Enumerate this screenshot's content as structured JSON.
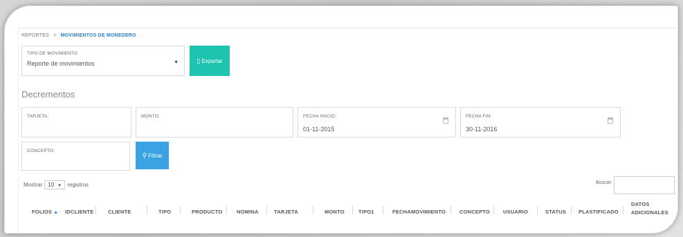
{
  "breadcrumb": {
    "parent": "REPORTES",
    "separator": ">",
    "current": "MOVIMIENTOS DE MONEDERO"
  },
  "movement_type": {
    "label": "TIPO DE MOVIMIENTO",
    "value": "Reporte de movimientos"
  },
  "export_button": {
    "label": "Exportar",
    "icon": "document-icon"
  },
  "section_title": "Decrementos",
  "filters": {
    "tarjeta": {
      "label": "TARJETA:"
    },
    "monto": {
      "label": "MONTO:"
    },
    "fecha_inicio": {
      "label": "FECHA INICIO:",
      "value": "01-11-2015"
    },
    "fecha_fin": {
      "label": "FECHA FIN:",
      "value": "30-11-2016"
    },
    "concepto": {
      "label": "CONCEPTO:"
    }
  },
  "filter_button": {
    "label": "Filtrar",
    "icon": "search-icon"
  },
  "table_length": {
    "prefix": "Mostrar",
    "value": "10",
    "suffix": "registros"
  },
  "search": {
    "label": "Buscar:"
  },
  "columns": [
    "FOLIOS",
    "IDCLIENTE",
    "CLIENTE",
    "TIPO",
    "PRODUCTO",
    "NOMINA",
    "TARJETA",
    "MONTO",
    "TIPO1",
    "FECHAMOVIMIENTO",
    "CONCEPTO",
    "USUARIO",
    "STATUS",
    "PLASTIFICADO",
    "DATOS",
    "ADICIONALES"
  ],
  "colors": {
    "accent_teal": "#1fc4b0",
    "accent_blue": "#3aa3e3",
    "link": "#2a7fd4"
  }
}
